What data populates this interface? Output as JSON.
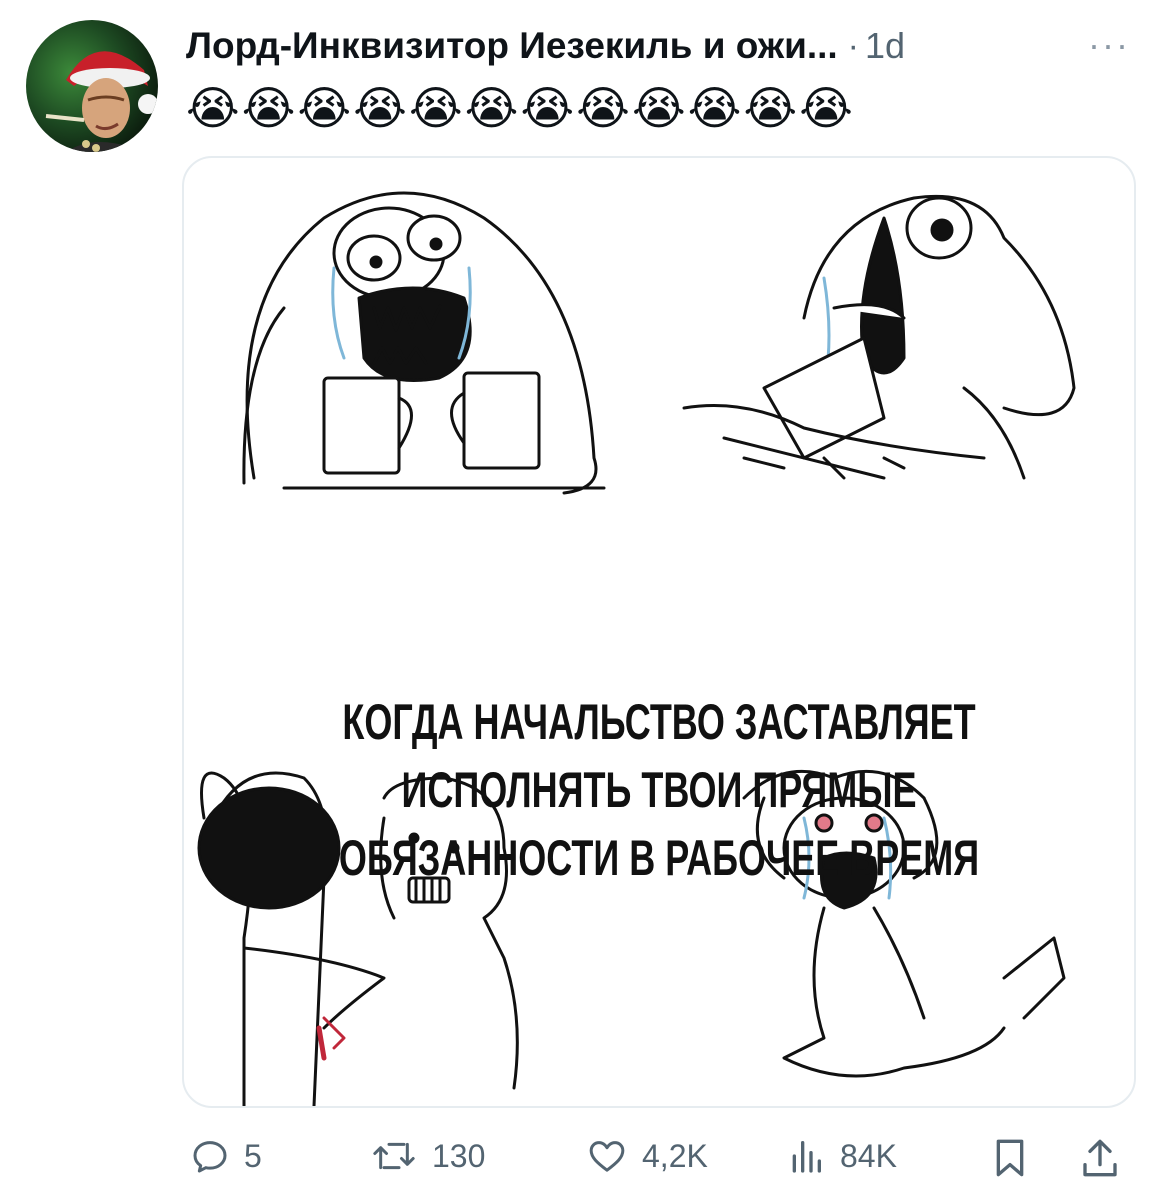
{
  "tweet": {
    "author_name": "Лорд-Инквизитор Иезекиль и ожи...",
    "separator": "·",
    "time": "1d",
    "more_label": "···",
    "text": "😭😭😭😭😭😭😭😭😭😭😭😭"
  },
  "media": {
    "caption_lines": [
      "КОГДА НАЧАЛЬСТВО ЗАСТАВЛЯЕТ",
      "ИСПОЛНЯТЬ ТВОИ ПРЯМЫЕ",
      "ОБЯЗАННОСТИ В РАБОЧЕЕ ВРЕМЯ"
    ]
  },
  "actions": {
    "replies": "5",
    "retweets": "130",
    "likes": "4,2K",
    "views": "84K"
  },
  "icons": {
    "reply": "reply-icon",
    "retweet": "retweet-icon",
    "like": "heart-icon",
    "views": "views-icon",
    "bookmark": "bookmark-icon",
    "share": "share-icon"
  },
  "colors": {
    "text": "#0f1419",
    "secondary": "#536471",
    "border": "#e6ecf0"
  }
}
